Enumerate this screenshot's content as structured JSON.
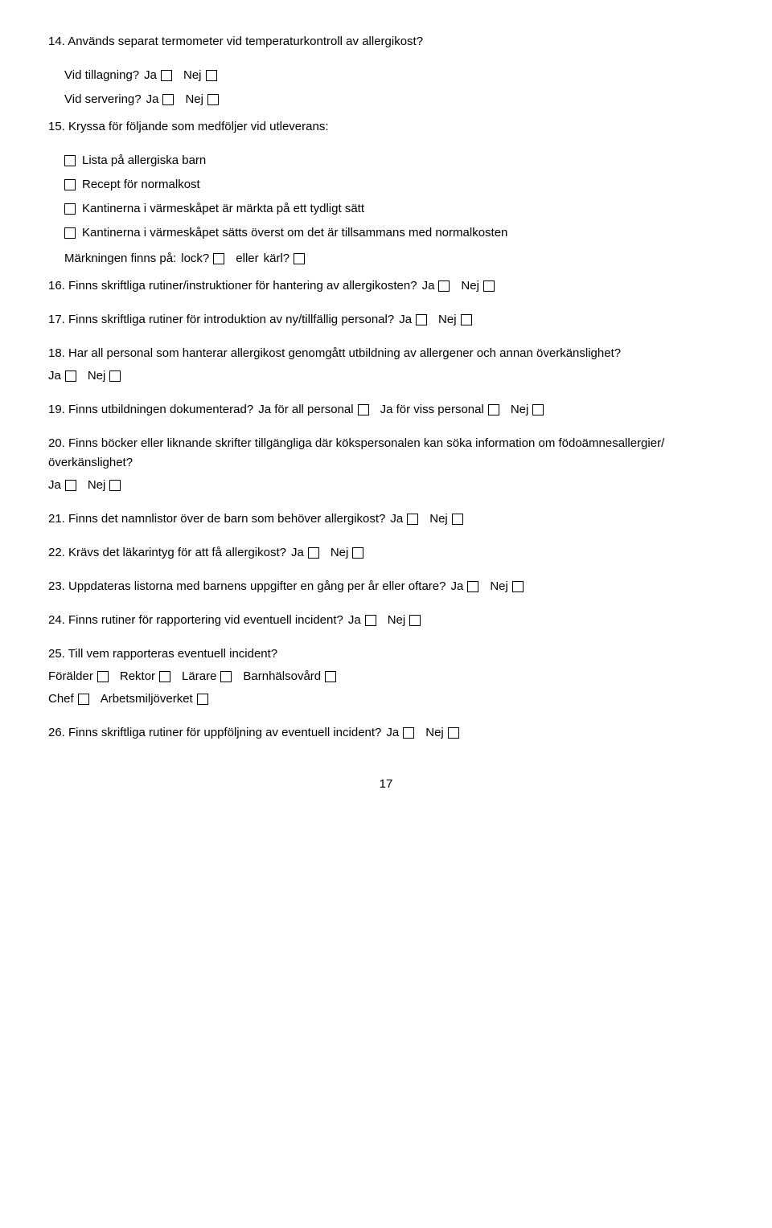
{
  "questions": [
    {
      "id": "q14_header",
      "text": "14. Används separat termometer vid temperaturkontroll av allergikost?"
    },
    {
      "id": "q14_vid_tillagning",
      "label": "Vid tillagning?",
      "options": [
        "Ja",
        "Nej"
      ]
    },
    {
      "id": "q14_vid_servering",
      "label": "Vid servering?",
      "options": [
        "Ja",
        "Nej"
      ]
    },
    {
      "id": "q15_header",
      "text": "15. Kryssa för följande som medföljer vid utleverans:"
    },
    {
      "id": "q15_items",
      "items": [
        "Lista på allergiska barn",
        "Recept för normalkost",
        "Kantinerna i värmeskåpet är märkta på ett tydligt sätt",
        "Kantinerna i värmeskåpet sätts överst om det är tillsammans med normalkosten"
      ]
    },
    {
      "id": "q15_marking",
      "text": "Märkningen finns på:",
      "options_inline": [
        "lock?",
        "eller",
        "kärl?"
      ]
    },
    {
      "id": "q16",
      "text": "16. Finns skriftliga rutiner/instruktioner för hantering av allergikosten?",
      "options": [
        "Ja",
        "Nej"
      ]
    },
    {
      "id": "q17",
      "text": "17. Finns skriftliga rutiner för introduktion av ny/tillfällig personal?",
      "options": [
        "Ja",
        "Nej"
      ]
    },
    {
      "id": "q18",
      "text": "18. Har all personal som hanterar allergikost genomgått utbildning av allergener och annan överkänslighet?",
      "options": [
        "Ja",
        "Nej"
      ]
    },
    {
      "id": "q19",
      "text": "19. Finns utbildningen dokumenterad?",
      "options_multi": [
        "Ja för all personal",
        "Ja för viss personal",
        "Nej"
      ]
    },
    {
      "id": "q20",
      "text": "20. Finns böcker eller liknande skrifter tillgängliga där kökspersonalen kan söka information om födoämnesallergier/överkänslighet?",
      "options": [
        "Ja",
        "Nej"
      ]
    },
    {
      "id": "q21",
      "text": "21. Finns det namnlistor över de barn som behöver allergikost?",
      "options": [
        "Ja",
        "Nej"
      ]
    },
    {
      "id": "q22",
      "text": "22. Krävs det läkarintyg för att få allergikost?",
      "options": [
        "Ja",
        "Nej"
      ]
    },
    {
      "id": "q23",
      "text": "23. Uppdateras listorna med barnens uppgifter en gång per år eller oftare?",
      "options": [
        "Ja",
        "Nej"
      ]
    },
    {
      "id": "q24",
      "text": "24. Finns rutiner för rapportering vid eventuell incident?",
      "options": [
        "Ja",
        "Nej"
      ]
    },
    {
      "id": "q25",
      "text": "25. Till vem rapporteras eventuell incident?",
      "options_multi": [
        "Förälder",
        "Rektor",
        "Lärare",
        "Barnhälsovård",
        "Chef",
        "Arbetsmiljöverket"
      ]
    },
    {
      "id": "q26",
      "text": "26. Finns skriftliga rutiner för uppföljning av eventuell incident?",
      "options": [
        "Ja",
        "Nej"
      ]
    }
  ],
  "page_number": "17",
  "labels": {
    "ja": "Ja",
    "nej": "Nej",
    "vid_tillagning": "Vid tillagning?",
    "vid_servering": "Vid servering?",
    "marking_text": "Märkningen finns på:",
    "lock": "lock?",
    "eller": "eller",
    "karl": "kärl?",
    "ja_all": "Ja för all personal",
    "ja_viss": "Ja för viss personal",
    "foraldrar": "Förälder",
    "rektor": "Rektor",
    "larare": "Lärare",
    "barnhalsovard": "Barnhälsovård",
    "chef": "Chef",
    "arbetsmiljoverket": "Arbetsmiljöverket"
  }
}
